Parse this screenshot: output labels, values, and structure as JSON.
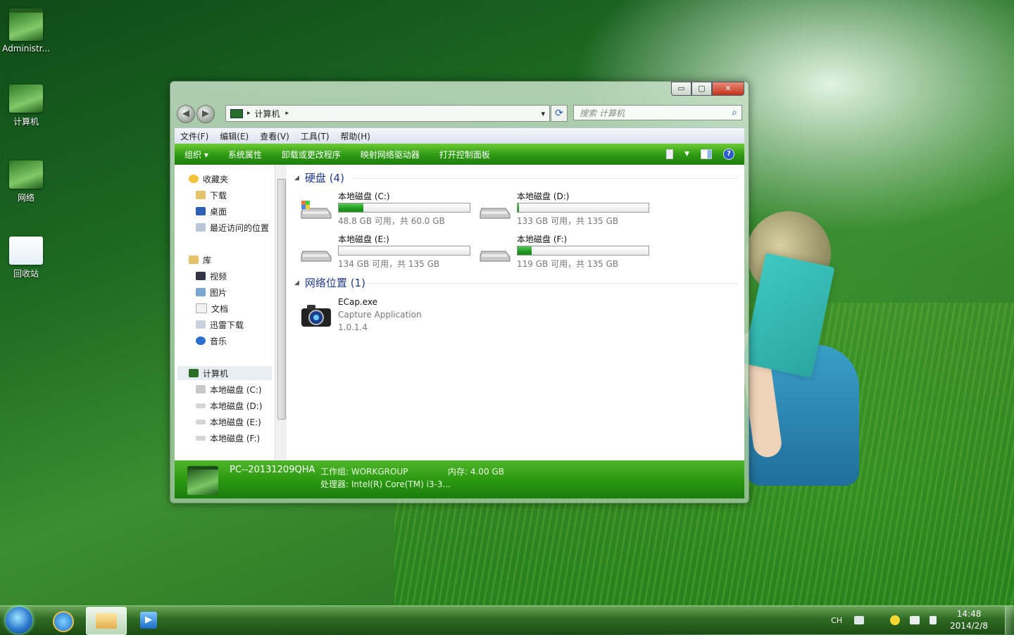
{
  "desktop": {
    "icons": [
      {
        "label": "Administr...",
        "icon": "user-folder-icon"
      },
      {
        "label": "计算机",
        "icon": "computer-icon"
      },
      {
        "label": "网络",
        "icon": "network-icon"
      },
      {
        "label": "回收站",
        "icon": "recycle-bin-icon"
      }
    ]
  },
  "window": {
    "caption_buttons": {
      "minimize": "▭",
      "maximize": "▢",
      "close": "✕"
    },
    "nav": {
      "back": "◀",
      "forward": "▶"
    },
    "address": {
      "path": "计算机",
      "sep": "▸",
      "dropdown": "▾"
    },
    "refresh": "⟳",
    "search": {
      "placeholder": "搜索 计算机",
      "icon": "⌕"
    },
    "menu": [
      "文件(F)",
      "编辑(E)",
      "查看(V)",
      "工具(T)",
      "帮助(H)"
    ],
    "commands": [
      "组织 ▾",
      "系统属性",
      "卸载或更改程序",
      "映射网络驱动器",
      "打开控制面板"
    ],
    "help": "?",
    "sidebar": {
      "favorites": {
        "label": "收藏夹",
        "items": [
          "下载",
          "桌面",
          "最近访问的位置"
        ]
      },
      "libraries": {
        "label": "库",
        "items": [
          "视频",
          "图片",
          "文档",
          "迅雷下载",
          "音乐"
        ]
      },
      "computer": {
        "label": "计算机",
        "items": [
          "本地磁盘 (C:)",
          "本地磁盘 (D:)",
          "本地磁盘 (E:)",
          "本地磁盘 (F:)"
        ]
      }
    },
    "groups": {
      "drives": {
        "label": "硬盘 (4)"
      },
      "network": {
        "label": "网络位置 (1)"
      }
    },
    "drives": [
      {
        "name": "本地磁盘 (C:)",
        "size_text": "48.8 GB 可用，共 60.0 GB",
        "used_fraction": 0.19
      },
      {
        "name": "本地磁盘 (D:)",
        "size_text": "133 GB 可用，共 135 GB",
        "used_fraction": 0.01
      },
      {
        "name": "本地磁盘 (E:)",
        "size_text": "134 GB 可用，共 135 GB",
        "used_fraction": 0.0
      },
      {
        "name": "本地磁盘 (F:)",
        "size_text": "119 GB 可用，共 135 GB",
        "used_fraction": 0.11
      }
    ],
    "network_item": {
      "name": "ECap.exe",
      "desc": "Capture Application",
      "version": "1.0.1.4"
    },
    "details": {
      "pc_name": "PC--20131209QHA",
      "workgroup": "工作组: WORKGROUP",
      "memory": "内存: 4.00 GB",
      "cpu": "处理器: Intel(R) Core(TM) i3-3..."
    }
  },
  "taskbar": {
    "lang": "CH",
    "time": "14:48",
    "date": "2014/2/8",
    "media_glyph": "▶"
  },
  "colors": {
    "accent_green": "#2c9a12",
    "link_blue": "#1e3a8a",
    "drive_bar": "#1e9a1e"
  }
}
